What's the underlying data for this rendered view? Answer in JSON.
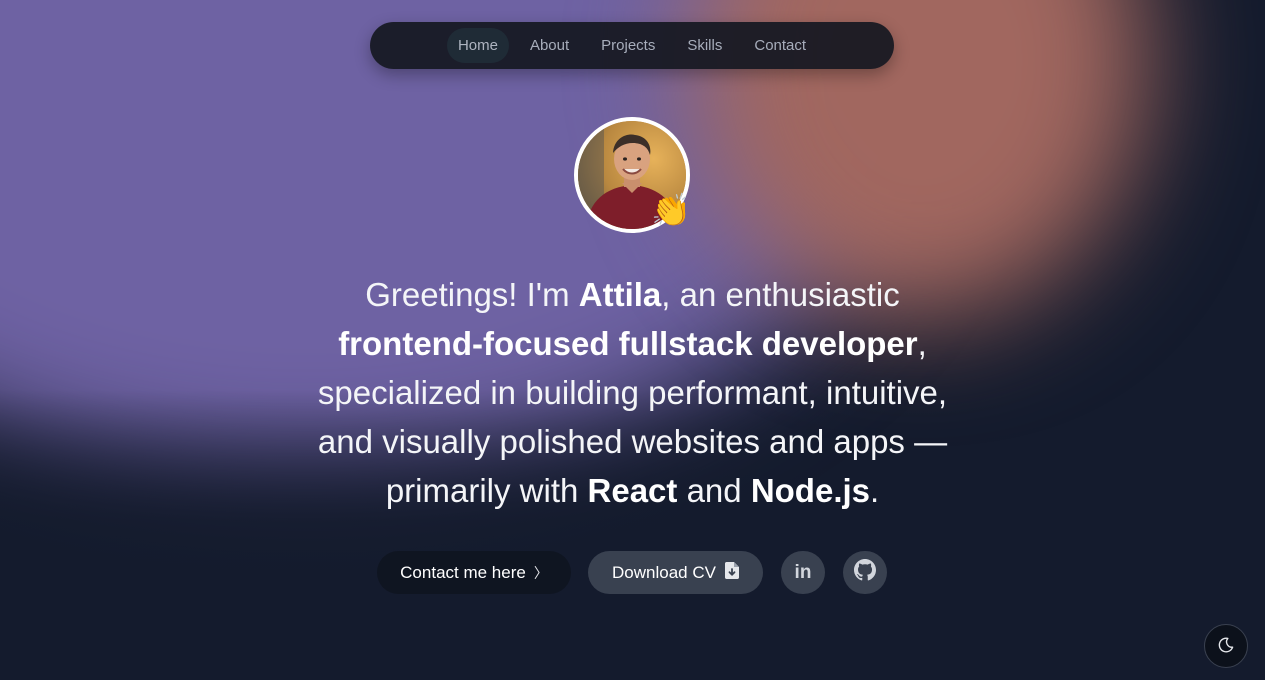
{
  "nav": {
    "items": [
      {
        "label": "Home",
        "active": true
      },
      {
        "label": "About",
        "active": false
      },
      {
        "label": "Projects",
        "active": false
      },
      {
        "label": "Skills",
        "active": false
      },
      {
        "label": "Contact",
        "active": false
      }
    ]
  },
  "hero": {
    "avatar_icon": "profile-photo",
    "wave_emoji": "👏",
    "headline": {
      "line1_a": "Greetings! I'm ",
      "name": "Attila",
      "line1_b": ", an enthusiastic",
      "role": "frontend-focused fullstack developer",
      "line2_end": ",",
      "line3": "specialized in building performant, intuitive,",
      "line4": "and visually polished websites and apps —",
      "line5_a": "primarily with ",
      "tech1": "React",
      "line5_and": " and ",
      "tech2": "Node.js",
      "line5_end": "."
    }
  },
  "actions": {
    "contact_label": "Contact me here",
    "contact_icon": "chevron-right-icon",
    "cv_label": "Download CV",
    "cv_icon": "file-download-icon",
    "linkedin_text": "in",
    "linkedin_icon": "linkedin-icon",
    "github_icon": "github-icon"
  },
  "theme_toggle": {
    "icon": "moon-icon"
  },
  "colors": {
    "background_dark": "#141b2d",
    "blob_purple": "#6e62a3",
    "blob_salmon": "#a1675f",
    "nav_bg": "#161822",
    "contact_button_bg": "#0f1521",
    "secondary_button_bg": "#394150"
  }
}
